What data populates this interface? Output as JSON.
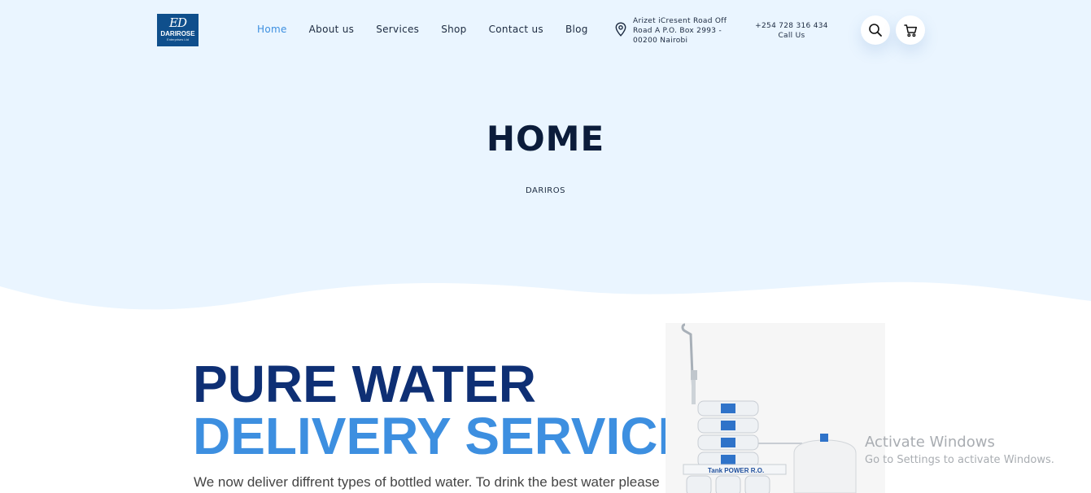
{
  "logo": {
    "mark": "ED",
    "name": "DARIROSE",
    "sub": "Enterprises Ltd"
  },
  "nav": {
    "items": [
      {
        "label": "Home",
        "active": true
      },
      {
        "label": "About us"
      },
      {
        "label": "Services"
      },
      {
        "label": "Shop"
      },
      {
        "label": "Contact us"
      },
      {
        "label": "Blog"
      }
    ]
  },
  "contact": {
    "address_lines": [
      "Arizet iCresent Road Off",
      "Road A P.O. Box 2993 -",
      "00200 Nairobi"
    ],
    "phone": "+254 728 316 434",
    "phone_label": "Call Us"
  },
  "header_icons": {
    "search": "search-icon",
    "cart": "cart-icon",
    "location": "map-pin-icon"
  },
  "page": {
    "title": "HOME",
    "breadcrumb": "DARIROS"
  },
  "hero": {
    "line1": "PURE WATER",
    "line2": "DELIVERY SERVICE",
    "intro": "We now deliver diffrent types of bottled water. To drink the best water please"
  },
  "product_image": {
    "brand_label": "Tank POWER R.O."
  },
  "watermark": {
    "title": "Activate Windows",
    "subtitle": "Go to Settings to activate Windows."
  },
  "colors": {
    "hero_bg": "#eaf5ff",
    "accent": "#3d8fe0",
    "navy": "#0e2f74",
    "title": "#0b1c3a"
  }
}
